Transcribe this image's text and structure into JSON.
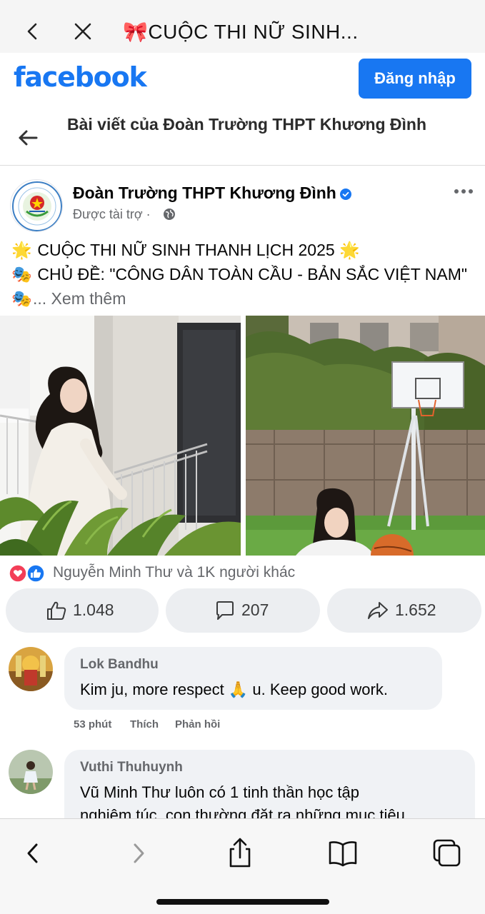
{
  "browser": {
    "tab_emoji": "🎀",
    "tab_title": "CUỘC THI NỮ SINH...",
    "back_icon": "chevron-left-icon",
    "close_icon": "close-icon"
  },
  "header": {
    "logo_text": "facebook",
    "login_label": "Đăng nhập",
    "brand_color": "#1877f2"
  },
  "page_nav": {
    "title": "Bài viết của Đoàn Trường THPT Khương Đình",
    "back_icon": "arrow-left-icon"
  },
  "post": {
    "page_name": "Đoàn Trường THPT Khương Đình",
    "verified_icon": "verified-badge-icon",
    "subtitle": "Được tài trợ ·",
    "lines": [
      {
        "emoji": "🌟",
        "text": " CUỘC THI NỮ SINH THANH LỊCH 2025 ",
        "emoji_end": "🌟"
      },
      {
        "emoji": "🎭",
        "text": " CHỦ ĐỀ: \"CÔNG DÂN TOÀN CẦU - BẢN SẮC VIỆT NAM\""
      },
      {
        "emoji": "🎭",
        "text": "... Xem thêm"
      }
    ],
    "photos": [
      {
        "subject": "student-in-white-dress-by-railing"
      },
      {
        "subject": "student-by-basketball-hoop"
      }
    ]
  },
  "reactions": {
    "icons": [
      "love-icon",
      "like-icon"
    ],
    "text": "Nguyễn Minh Thư và 1K người khác"
  },
  "actions": {
    "like_count": "1.048",
    "comment_count": "207",
    "share_count": "1.652"
  },
  "comments": [
    {
      "author": "Lok Bandhu",
      "text_before": "Kim ju, more respect ",
      "emoji": "🙏",
      "text_after": " u. Keep good work.",
      "time": "53 phút",
      "like_label": "Thích",
      "reply_label": "Phản hồi"
    },
    {
      "author": "Vuthi Thuhuynh",
      "line1": "Vũ Minh Thư luôn có 1 tinh thần học tập",
      "line2": "nghiêm túc, con thường đặt ra những mục tiêu"
    }
  ],
  "bottom_bar": {
    "icons": [
      "back-icon",
      "forward-icon",
      "share-icon",
      "bookmarks-icon",
      "tabs-icon"
    ]
  }
}
